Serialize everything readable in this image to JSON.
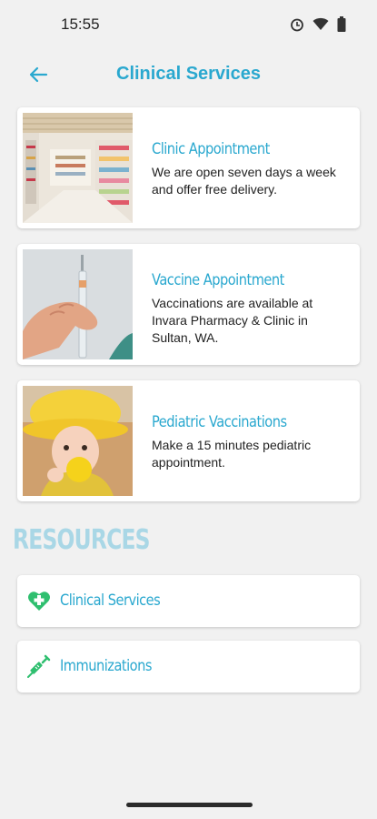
{
  "status_bar": {
    "time": "15:55"
  },
  "app_bar": {
    "title": "Clinical Services"
  },
  "cards": [
    {
      "title": "Clinic Appointment",
      "description": "We are open seven days a week and offer free delivery."
    },
    {
      "title": "Vaccine Appointment",
      "description": "Vaccinations are available at Invara Pharmacy & Clinic in Sultan, WA."
    },
    {
      "title": "Pediatric Vaccinations",
      "description": "Make a 15 minutes pediatric appointment."
    }
  ],
  "resources": {
    "heading": "RESOURCES",
    "items": [
      {
        "label": "Clinical Services",
        "icon": "heart-plus-icon"
      },
      {
        "label": "Immunizations",
        "icon": "syringe-icon"
      }
    ]
  },
  "colors": {
    "accent": "#2aa8cf",
    "heading_light": "#a9d7e6",
    "icon_green": "#2fbf6f",
    "background": "#f1f1f1"
  }
}
